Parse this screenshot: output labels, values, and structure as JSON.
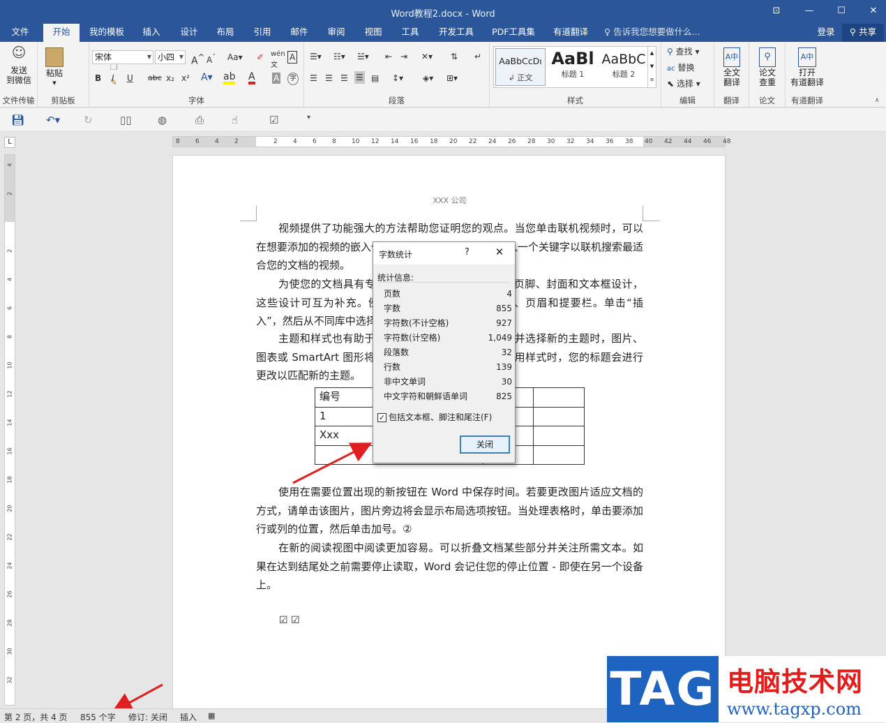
{
  "window": {
    "title": "Word教程2.docx - Word",
    "buttons": {
      "restore_ribbon": "⊡",
      "minimize": "—",
      "maximize": "☐",
      "close": "✕"
    }
  },
  "tabs": [
    {
      "label": "文件"
    },
    {
      "label": "开始"
    },
    {
      "label": "我的模板"
    },
    {
      "label": "插入"
    },
    {
      "label": "设计"
    },
    {
      "label": "布局"
    },
    {
      "label": "引用"
    },
    {
      "label": "邮件"
    },
    {
      "label": "审阅"
    },
    {
      "label": "视图"
    },
    {
      "label": "工具"
    },
    {
      "label": "开发工具"
    },
    {
      "label": "PDF工具集"
    },
    {
      "label": "有道翻译"
    }
  ],
  "tell_me": "告诉我您想要做什么...",
  "account": {
    "signin": "登录",
    "share": "共享"
  },
  "ribbon": {
    "wechat": {
      "label": "发送\n到微信",
      "group": "文件传输"
    },
    "clipboard": {
      "paste": "粘贴",
      "group": "剪贴板"
    },
    "font": {
      "name": "宋体",
      "size": "小四",
      "group": "字体",
      "bold": "B",
      "italic": "I",
      "underline": "U",
      "strike": "abc",
      "sub": "x₂",
      "sup": "x²"
    },
    "paragraph": {
      "group": "段落"
    },
    "styles": {
      "group": "样式",
      "items": [
        {
          "preview": "AaBbCcDı",
          "name": "↲ 正文"
        },
        {
          "preview": "AaBl",
          "name": "标题 1"
        },
        {
          "preview": "AaBbC",
          "name": "标题 2"
        }
      ]
    },
    "editing": {
      "find": "查找",
      "replace": "替换",
      "select": "选择",
      "group": "编辑"
    },
    "translate": {
      "label": "全文\n翻译",
      "group": "翻译"
    },
    "paper": {
      "label": "论文\n查重",
      "group": "论文"
    },
    "youdao": {
      "label": "打开\n有道翻译",
      "group": "有道翻译"
    }
  },
  "ruler": {
    "h_ticks": [
      "8",
      "6",
      "4",
      "2",
      "",
      "2",
      "4",
      "6",
      "8",
      "10",
      "12",
      "14",
      "16",
      "18",
      "20",
      "22",
      "24",
      "26",
      "28",
      "30",
      "32",
      "34",
      "36",
      "38",
      "40",
      "42",
      "44",
      "46",
      "48"
    ],
    "v_ticks": [
      "4",
      "2",
      "",
      "2",
      "4",
      "6",
      "8",
      "10",
      "12",
      "14",
      "16",
      "18",
      "20",
      "22",
      "24",
      "26",
      "28",
      "30",
      "32"
    ]
  },
  "document": {
    "header": "XXX 公司",
    "paragraphs": [
      "视频提供了功能强大的方法帮助您证明您的观点。当您单击联机视频时，可以在想要添加的视频的嵌入代码中进行粘贴。您也可以键入一个关键字以联机搜索最适合您的文档的视频。",
      "为使您的文档具有专业外观，Word 提供了页眉、页脚、封面和文本框设计，这些设计可互为补充。例如，您可以添加匹配的封面、页眉和提要栏。单击“插入”，然后从不同库中选择所需元素。",
      "主题和样式也有助于文档保持协调。当您单击设计并选择新的主题时，图片、图表或 SmartArt 图形将会更改以匹配新的主题。当应用样式时，您的标题会进行更改以匹配新的主题。",
      "使用在需要位置出现的新按钮在 Word 中保存时间。若要更改图片适应文档的方式，请单击该图片，图片旁边将会显示布局选项按钮。当处理表格时，单击要添加行或列的位置，然后单击加号。②",
      "在新的阅读视图中阅读更加容易。可以折叠文档某些部分并关注所需文本。如果在达到结尾处之前需要停止读取，Word 会记住您的停止位置 - 即使在另一个设备上。"
    ],
    "table": [
      [
        "编号",
        "",
        ""
      ],
      [
        "1",
        "",
        ""
      ],
      [
        "Xxx",
        "",
        ""
      ],
      [
        "",
        "",
        ""
      ]
    ],
    "checks": "☑ ☑"
  },
  "dialog": {
    "title": "字数统计",
    "help": "?",
    "close": "✕",
    "section": "统计信息:",
    "rows": [
      {
        "label": "页数",
        "value": "4"
      },
      {
        "label": "字数",
        "value": "855"
      },
      {
        "label": "字符数(不计空格)",
        "value": "927"
      },
      {
        "label": "字符数(计空格)",
        "value": "1,049"
      },
      {
        "label": "段落数",
        "value": "32"
      },
      {
        "label": "行数",
        "value": "139"
      },
      {
        "label": "非中文单词",
        "value": "30"
      },
      {
        "label": "中文字符和朝鲜语单词",
        "value": "825"
      }
    ],
    "checkbox": "包括文本框、脚注和尾注(F)",
    "checkbox_checked": "✓",
    "close_button": "关闭"
  },
  "status": {
    "page": "第 2 页，共 4 页",
    "words": "855 个字",
    "track": "修订: 关闭",
    "mode": "插入"
  },
  "watermark": {
    "tag": "TAG",
    "cn": "电脑技术网",
    "url": "www.tagxp.com"
  },
  "colors": {
    "accent": "#2b579a",
    "arrow": "#e02020"
  }
}
